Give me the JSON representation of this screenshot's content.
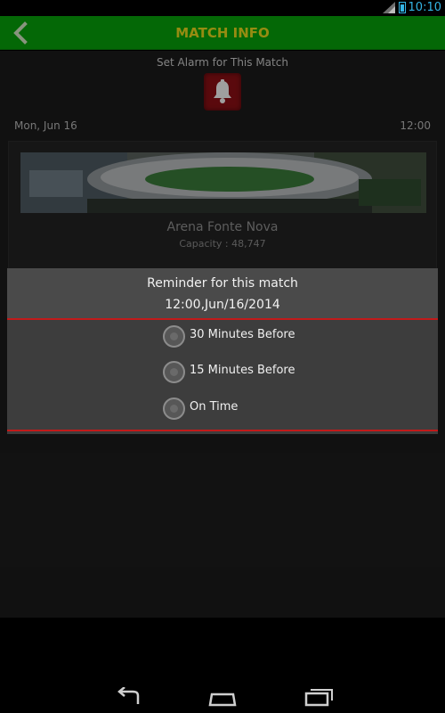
{
  "status_bar": {
    "time": "10:10"
  },
  "action_bar": {
    "title": "MATCH INFO"
  },
  "alarm": {
    "caption": "Set Alarm for This Match",
    "icon": "bell-icon"
  },
  "match": {
    "date": "Mon, Jun 16",
    "time": "12:00"
  },
  "venue": {
    "name": "Arena Fonte Nova",
    "capacity": "Capacity : 48,747"
  },
  "dialog": {
    "title": "Reminder for this match",
    "subtitle": "12:00,Jun/16/2014",
    "options": [
      {
        "label": "30 Minutes Before"
      },
      {
        "label": "15 Minutes Before"
      },
      {
        "label": "On Time"
      }
    ]
  },
  "colors": {
    "action_bar": "#07a00a",
    "title_text": "#e7d71d",
    "accent_red": "#c21a1a",
    "alarm_button": "#8b0f14"
  }
}
